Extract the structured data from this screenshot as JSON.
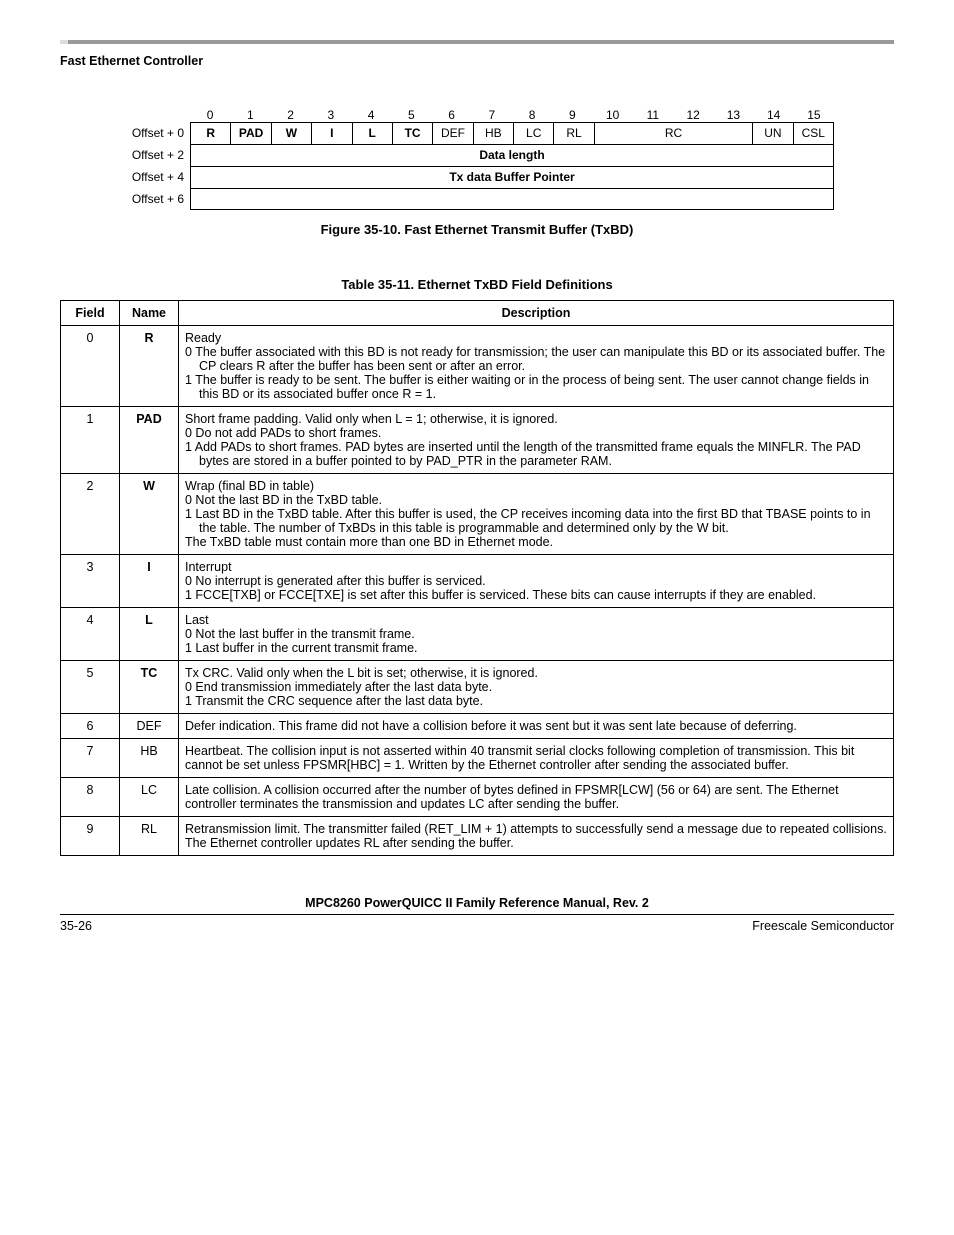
{
  "header": {
    "section": "Fast Ethernet Controller"
  },
  "bitDiagram": {
    "bitNumbers": [
      "0",
      "1",
      "2",
      "3",
      "4",
      "5",
      "6",
      "7",
      "8",
      "9",
      "10",
      "11",
      "12",
      "13",
      "14",
      "15"
    ],
    "rows": [
      {
        "label": "Offset + 0",
        "cells": [
          {
            "text": "R",
            "bold": true
          },
          {
            "text": "PAD",
            "bold": true
          },
          {
            "text": "W",
            "bold": true
          },
          {
            "text": "I",
            "bold": true
          },
          {
            "text": "L",
            "bold": true
          },
          {
            "text": "TC",
            "bold": true
          },
          {
            "text": "DEF"
          },
          {
            "text": "HB"
          },
          {
            "text": "LC"
          },
          {
            "text": "RL"
          },
          {
            "text": "RC",
            "span": 4
          },
          {
            "text": "UN"
          },
          {
            "text": "CSL"
          }
        ]
      },
      {
        "label": "Offset + 2",
        "cells": [
          {
            "text": "Data length",
            "span": 16,
            "bold": true
          }
        ]
      },
      {
        "label": "Offset + 4",
        "cells": [
          {
            "text": "Tx data Buffer Pointer",
            "span": 16,
            "bold": true
          }
        ],
        "noBottom": true
      },
      {
        "label": "Offset + 6",
        "cells": [
          {
            "text": "",
            "span": 16
          }
        ],
        "last": true
      }
    ],
    "caption": "Figure 35-10. Fast Ethernet Transmit Buffer (TxBD)"
  },
  "table": {
    "caption": "Table 35-11. Ethernet TxBD Field Definitions",
    "headers": [
      "Field",
      "Name",
      "Description"
    ],
    "rows": [
      {
        "field": "0",
        "name": "R",
        "bold": true,
        "lines": [
          "Ready",
          "0  The buffer associated with this BD is not ready for transmission; the user can manipulate this BD or its associated buffer. The CP clears R after the buffer has been sent or after an error.",
          "1  The buffer is ready to be sent. The buffer is either waiting or in the process of being sent. The user cannot change fields in this BD or its associated buffer once R = 1."
        ]
      },
      {
        "field": "1",
        "name": "PAD",
        "bold": true,
        "lines": [
          "Short frame padding. Valid only when L = 1; otherwise, it is ignored.",
          "0  Do not add PADs to short frames.",
          "1  Add PADs to short frames. PAD bytes are inserted until the length of the transmitted frame equals the MINFLR. The PAD bytes are stored in a buffer pointed to by PAD_PTR in the parameter RAM."
        ]
      },
      {
        "field": "2",
        "name": "W",
        "bold": true,
        "lines": [
          "Wrap (final BD in table)",
          "0  Not the last BD in the TxBD table.",
          "1  Last BD in the TxBD table. After this buffer is used, the CP receives incoming data into the first BD that TBASE points to in the table. The number of TxBDs in this table is programmable and determined only by the W bit.",
          "The TxBD table must contain more than one BD in Ethernet mode."
        ]
      },
      {
        "field": "3",
        "name": "I",
        "bold": true,
        "lines": [
          "Interrupt",
          "0  No interrupt is generated after this buffer is serviced.",
          "1  FCCE[TXB] or FCCE[TXE] is set after this buffer is serviced. These bits can cause interrupts if they are enabled."
        ]
      },
      {
        "field": "4",
        "name": "L",
        "bold": true,
        "lines": [
          "Last",
          "0  Not the last buffer in the transmit frame.",
          "1  Last buffer in the current transmit frame."
        ]
      },
      {
        "field": "5",
        "name": "TC",
        "bold": true,
        "lines": [
          "Tx CRC. Valid only when the L bit is set; otherwise, it is ignored.",
          "0  End transmission immediately after the last data byte.",
          "1  Transmit the CRC sequence after the last data byte."
        ]
      },
      {
        "field": "6",
        "name": "DEF",
        "bold": false,
        "lines": [
          "Defer indication. This frame did not have a collision before it was sent but it was sent late because of deferring."
        ]
      },
      {
        "field": "7",
        "name": "HB",
        "bold": false,
        "lines": [
          "Heartbeat. The collision input is not asserted within 40 transmit serial clocks following completion of transmission. This bit cannot be set unless FPSMR[HBC] = 1. Written by the Ethernet controller after sending the associated buffer."
        ]
      },
      {
        "field": "8",
        "name": "LC",
        "bold": false,
        "lines": [
          "Late collision. A collision occurred after the number of bytes defined in FPSMR[LCW] (56 or 64) are sent. The Ethernet controller terminates the transmission and updates LC after sending the buffer."
        ]
      },
      {
        "field": "9",
        "name": "RL",
        "bold": false,
        "lines": [
          "Retransmission limit. The transmitter failed (RET_LIM + 1) attempts to successfully send a message due to repeated collisions. The Ethernet controller updates RL after sending the buffer."
        ]
      }
    ]
  },
  "footer": {
    "manual": "MPC8260 PowerQUICC II Family Reference Manual, Rev. 2",
    "page": "35-26",
    "vendor": "Freescale Semiconductor"
  }
}
